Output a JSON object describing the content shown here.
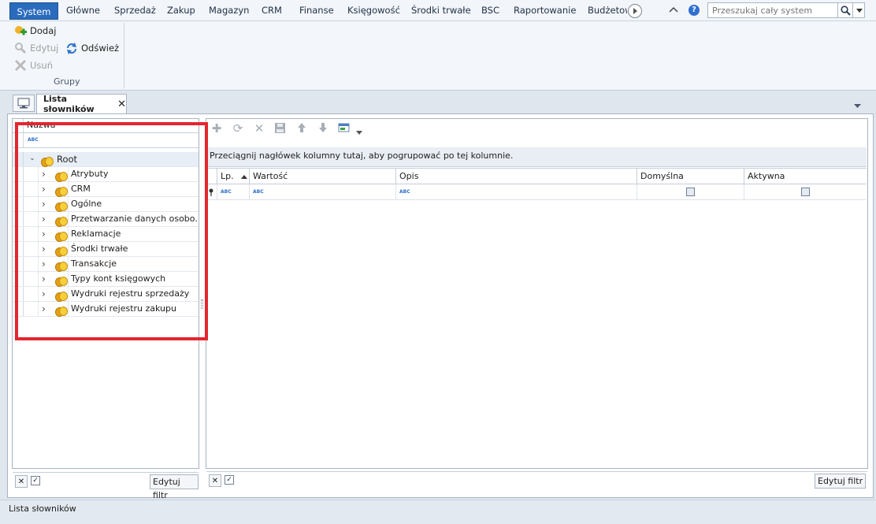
{
  "menubar": {
    "items": [
      "System",
      "Główne",
      "Sprzedaż",
      "Zakup",
      "Magazyn",
      "CRM",
      "Finanse",
      "Księgowość",
      "Środki trwałe",
      "BSC",
      "Raportowanie",
      "Budżetow"
    ],
    "search_placeholder": "Przeszukaj cały system"
  },
  "ribbon": {
    "add": "Dodaj",
    "edit": "Edytuj",
    "refresh": "Odśwież",
    "delete": "Usuń",
    "group_label": "Grupy"
  },
  "tab": {
    "title": "Lista słowników"
  },
  "tree": {
    "header": "Nazwa",
    "root": "Root",
    "children": [
      "Atrybuty",
      "CRM",
      "Ogólne",
      "Przetwarzanie danych osobo...",
      "Reklamacje",
      "Środki trwałe",
      "Transakcje",
      "Typy kont księgowych",
      "Wydruki rejestru sprzedaży",
      "Wydruki rejestru zakupu"
    ],
    "edit_filter": "Edytuj filtr"
  },
  "grid": {
    "group_hint": "Przeciągnij nagłówek kolumny tutaj, aby pogrupować po tej kolumnie.",
    "columns": [
      "Lp.",
      "Wartość",
      "Opis",
      "Domyślna",
      "Aktywna"
    ],
    "edit_filter": "Edytuj filtr"
  },
  "status": {
    "text": "Lista słowników"
  },
  "colors": {
    "accent": "#2a6bbd",
    "highlight": "#e3262f"
  }
}
